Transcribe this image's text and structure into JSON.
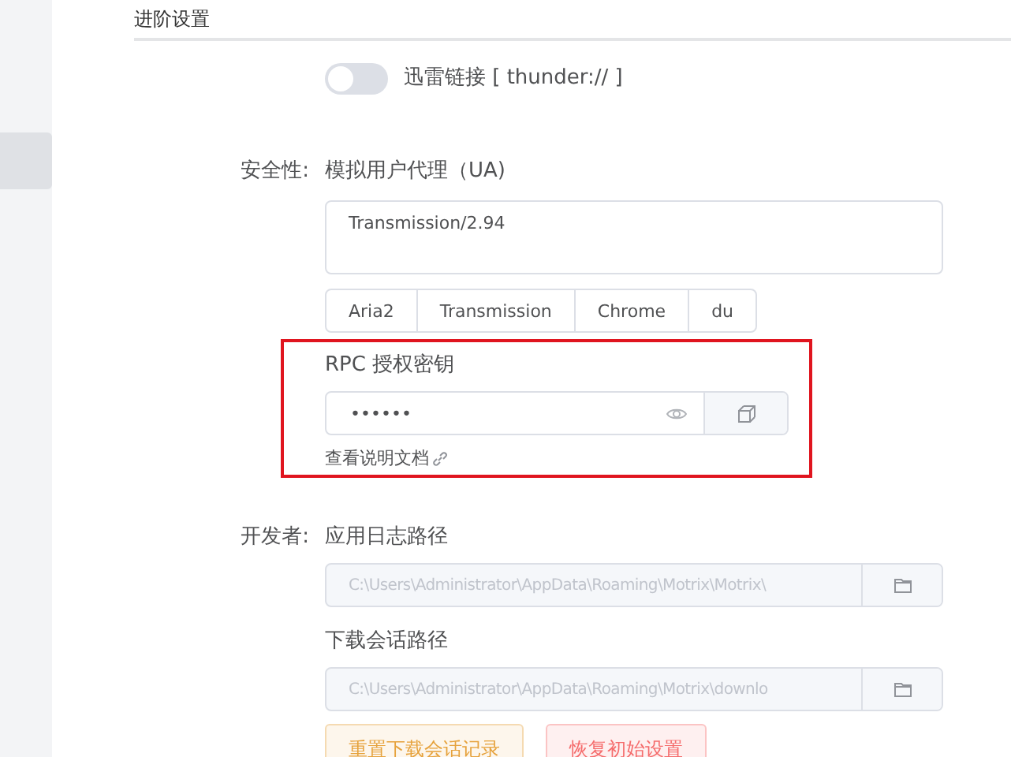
{
  "sidebar": {
    "items": [
      {
        "selected": true
      }
    ]
  },
  "header": {
    "title": "进阶设置"
  },
  "thunder_toggle": {
    "label": "迅雷链接 [ thunder:// ]",
    "on": false
  },
  "security": {
    "label": "安全性:",
    "ua_title": "模拟用户代理（UA)",
    "ua_value": "Transmission/2.94",
    "ua_presets": [
      "Aria2",
      "Transmission",
      "Chrome",
      "du"
    ],
    "rpc_title": "RPC 授权密钥",
    "rpc_value": "••••••",
    "doc_link": "查看说明文档",
    "highlighted": true
  },
  "developer": {
    "label": "开发者:",
    "paths": [
      {
        "title": "应用日志路径",
        "value": "C:\\Users\\Administrator\\AppData\\Roaming\\Motrix\\Motrix\\"
      },
      {
        "title": "下载会话路径",
        "value": "C:\\Users\\Administrator\\AppData\\Roaming\\Motrix\\downlo"
      }
    ],
    "buttons": [
      {
        "label": "重置下载会话记录",
        "kind": "warning"
      },
      {
        "label": "恢复初始设置",
        "kind": "danger"
      }
    ]
  }
}
